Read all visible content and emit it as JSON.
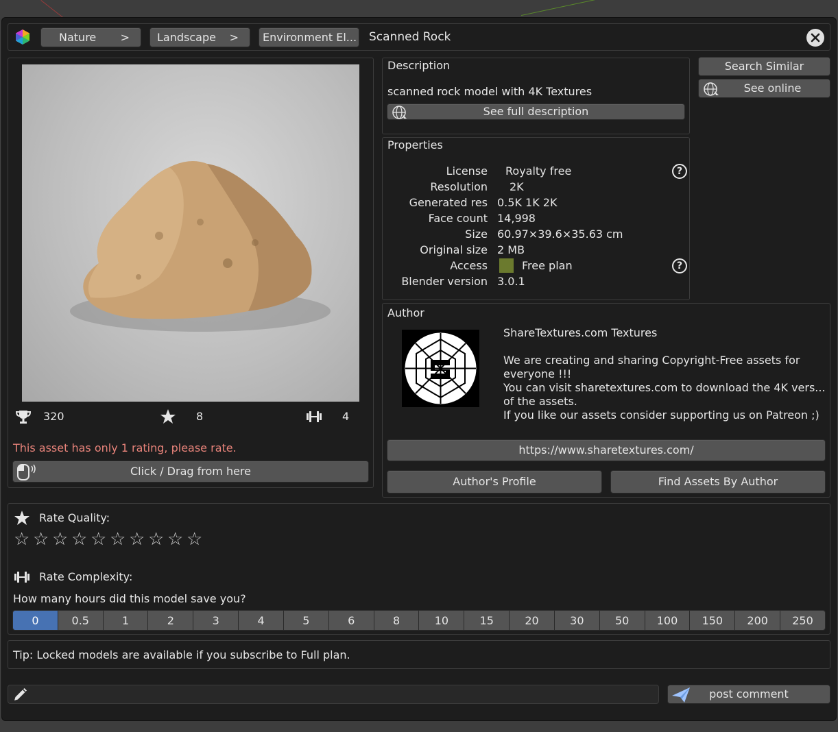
{
  "breadcrumbs": [
    {
      "label": "Nature",
      "arrow": ">"
    },
    {
      "label": "Landscape",
      "arrow": ">"
    },
    {
      "label": "Environment El...",
      "arrow": ""
    }
  ],
  "title": "Scanned Rock",
  "stats": {
    "downloads": "320",
    "rating_count": "8",
    "complexity": "4"
  },
  "rating_warning": "This asset has only 1 rating, please rate.",
  "drag_button": "Click / Drag from here",
  "description": {
    "header": "Description",
    "text": "scanned rock model with 4K Textures",
    "full_button": "See full description"
  },
  "side_buttons": {
    "search_similar": "Search Similar",
    "see_online": "See online"
  },
  "properties": {
    "header": "Properties",
    "rows": [
      {
        "label": "License",
        "value": "Royalty free"
      },
      {
        "label": "Resolution",
        "value": "2K"
      },
      {
        "label": "Generated res",
        "value": "0.5K 1K 2K"
      },
      {
        "label": "Face count",
        "value": "14,998"
      },
      {
        "label": "Size",
        "value": "60.97×39.6×35.63 cm"
      },
      {
        "label": "Original size",
        "value": "2 MB"
      },
      {
        "label": "Access",
        "value": "Free plan"
      },
      {
        "label": "Blender version",
        "value": "3.0.1"
      }
    ],
    "help_glyph": "?",
    "access_color": "#6b7a2e"
  },
  "author": {
    "header": "Author",
    "name": "ShareTextures.com Textures",
    "bio_lines": [
      "We are creating and sharing Copyright-Free assets for",
      "everyone !!!",
      "You can visit sharetextures.com to download the 4K vers...",
      "of the assets.",
      "If you like our assets consider supporting us on Patreon ;)"
    ],
    "url_button": "https://www.sharetextures.com/",
    "profile_button": "Author's Profile",
    "find_button": "Find Assets By Author"
  },
  "rating": {
    "quality_label": "Rate Quality:",
    "star_glyph": "☆",
    "complexity_label": "Rate Complexity:",
    "hours_question": "How many hours did this model save you?",
    "hours": [
      "0",
      "0.5",
      "1",
      "2",
      "3",
      "4",
      "5",
      "6",
      "8",
      "10",
      "15",
      "20",
      "30",
      "50",
      "100",
      "150",
      "200",
      "250"
    ],
    "selected_hours": "0"
  },
  "tip": "Tip: Locked models are available if you subscribe to Full plan.",
  "comment": {
    "placeholder": "",
    "post_button": "post comment"
  },
  "colors": {
    "accent": "#4772b3",
    "warning": "#e8837a"
  }
}
